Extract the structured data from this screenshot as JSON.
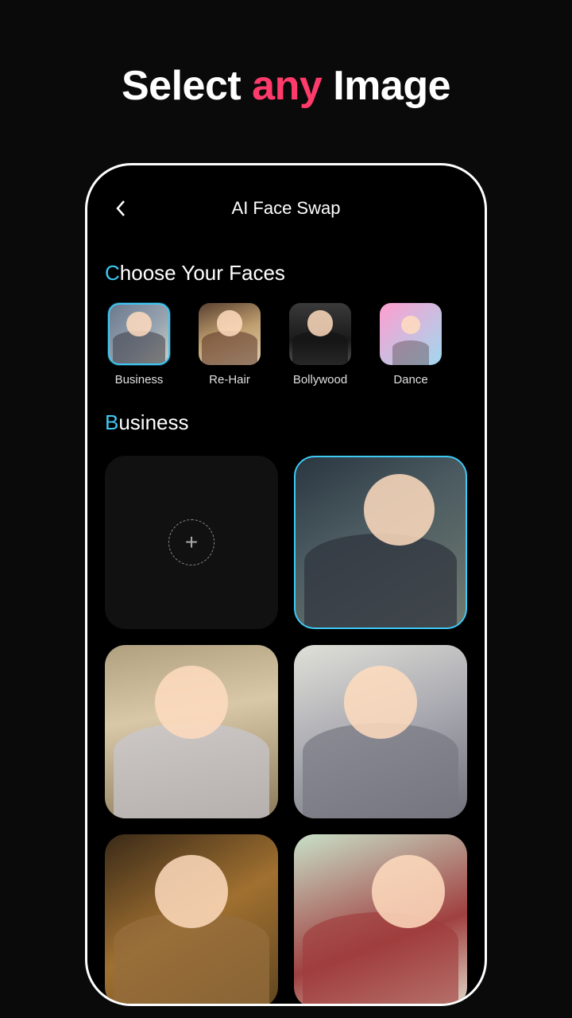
{
  "hero": {
    "part1": "Select ",
    "accent": "any",
    "part2": " Image"
  },
  "app": {
    "title": "AI Face Swap"
  },
  "sections": {
    "choose_first": "C",
    "choose_rest": "hoose Your Faces",
    "category_first": "B",
    "category_rest": "usiness"
  },
  "faces": [
    {
      "label": "Business",
      "selected": true
    },
    {
      "label": "Re-Hair",
      "selected": false
    },
    {
      "label": "Bollywood",
      "selected": false
    },
    {
      "label": "Dance",
      "selected": false
    }
  ],
  "grid": {
    "add_icon": "+",
    "tiles": [
      {
        "type": "add"
      },
      {
        "type": "image",
        "selected": true
      },
      {
        "type": "image",
        "selected": false
      },
      {
        "type": "image",
        "selected": false
      },
      {
        "type": "image",
        "selected": false
      },
      {
        "type": "image",
        "selected": false
      }
    ]
  }
}
